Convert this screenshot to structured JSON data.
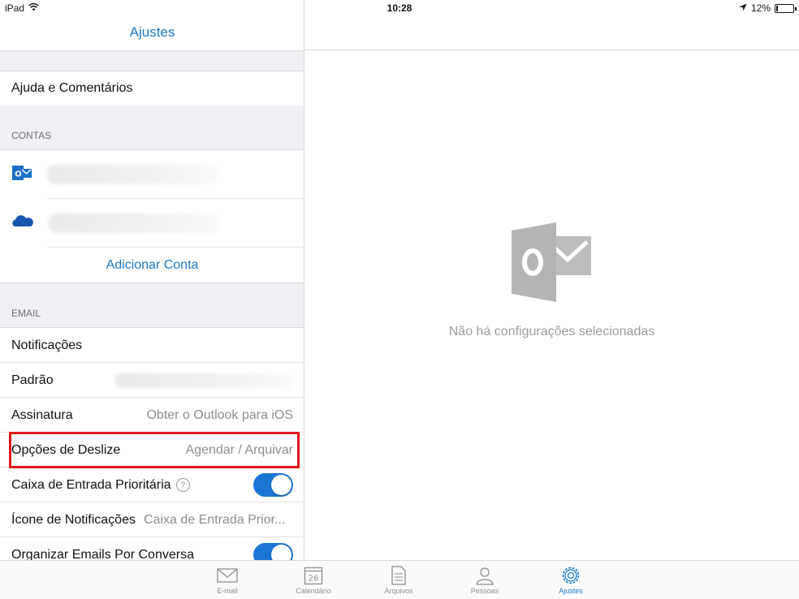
{
  "status_bar": {
    "device": "iPad",
    "time": "10:28",
    "battery": "12%",
    "battery_level": 0.12
  },
  "settings": {
    "title": "Ajustes",
    "help_feedback": "Ajuda e Comentários",
    "accounts_header": "CONTAS",
    "account_icons": [
      "outlook-icon",
      "onedrive-icon"
    ],
    "add_account": "Adicionar Conta",
    "email_header": "EMAIL",
    "rows": {
      "notifications": "Notificações",
      "default_label": "Padrão",
      "signature_label": "Assinatura",
      "signature_value": "Obter o Outlook para iOS",
      "swipe_label": "Opções de Deslize",
      "swipe_value": "Agendar / Arquivar",
      "focused_inbox_label": "Caixa de Entrada Prioritária",
      "focused_inbox_help": "?",
      "focused_inbox_on": true,
      "badge_label": "Ícone de Notificações",
      "badge_value": "Caixa de Entrada Prior...",
      "threading_label": "Organizar Emails Por Conversa",
      "threading_on": true
    }
  },
  "detail": {
    "empty_message": "Não há configurações selecionadas"
  },
  "tabbar": {
    "tabs": [
      {
        "label": "E-mail",
        "icon": "mail-icon"
      },
      {
        "label": "Calendário",
        "icon": "calendar-icon",
        "badge": "26"
      },
      {
        "label": "Arquivos",
        "icon": "files-icon"
      },
      {
        "label": "Pessoas",
        "icon": "people-icon"
      },
      {
        "label": "Ajustes",
        "icon": "gear-icon",
        "active": true
      }
    ]
  },
  "colors": {
    "accent": "#1b7ac9",
    "toggle_on": "#1b76d3",
    "highlight": "#e01919",
    "muted": "#8e8e93"
  }
}
